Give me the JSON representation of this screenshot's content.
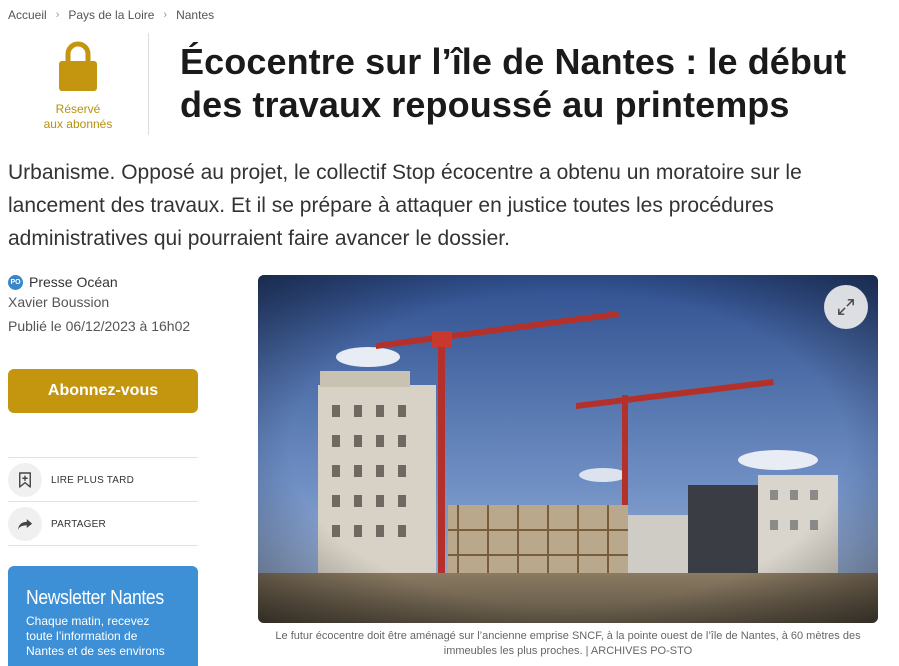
{
  "breadcrumb": [
    "Accueil",
    "Pays de la Loire",
    "Nantes"
  ],
  "premium": {
    "label_line1": "Réservé",
    "label_line2": "aux abonnés"
  },
  "article": {
    "title": "Écocentre sur l’île de Nantes : le début des travaux repoussé au printemps",
    "chapo": "Urbanisme. Opposé au projet, le collectif Stop écocentre a obtenu un moratoire sur le lancement des travaux. Et il se prépare à attaquer en justice toutes les procédures administratives qui pourraient faire avancer le dossier.",
    "source_badge": "PO",
    "source": "Presse Océan",
    "author": "Xavier Boussion",
    "published": "Publié le 06/12/2023 à 16h02"
  },
  "actions": {
    "subscribe_label": "Abonnez-vous",
    "read_later": "LIRE PLUS TARD",
    "share": "PARTAGER"
  },
  "newsletter": {
    "title": "Newsletter Nantes",
    "text_line1": "Chaque matin, recevez",
    "text_line2": "toute l’information de",
    "text_line3": "Nantes et de ses environs"
  },
  "figure": {
    "caption": "Le futur écocentre doit être aménagé sur l’ancienne emprise SNCF, à la pointe ouest de l’île de Nantes, à 60 mètres des immeubles les plus proches. | ARCHIVES PO-STO"
  },
  "colors": {
    "accent_gold": "#c4960f",
    "newsletter_blue": "#3d8fd6",
    "badge_blue": "#3a86c8"
  },
  "icons": [
    "chevron-right-icon",
    "lock-icon",
    "bookmark-icon",
    "share-arrow-icon",
    "expand-icon"
  ]
}
